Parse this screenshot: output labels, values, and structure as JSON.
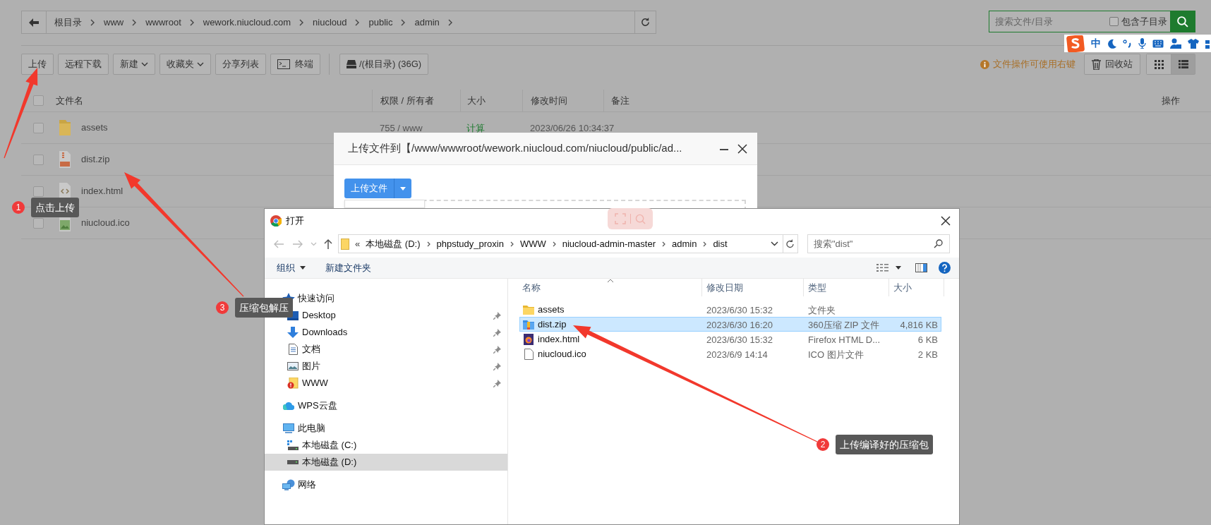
{
  "breadcrumb": {
    "segments": [
      "根目录",
      "www",
      "wwwroot",
      "wework.niucloud.com",
      "niucloud",
      "public",
      "admin"
    ]
  },
  "search": {
    "placeholder": "搜索文件/目录",
    "include_subdirs": {
      "label": "包含子目录",
      "checked": false
    }
  },
  "ime_toolbar": {
    "mode": "中"
  },
  "toolbar": [
    {
      "kind": "plain",
      "label": "上传"
    },
    {
      "kind": "plain",
      "label": "远程下载"
    },
    {
      "kind": "dropdown",
      "label": "新建"
    },
    {
      "kind": "dropdown",
      "label": "收藏夹"
    },
    {
      "kind": "plain",
      "label": "分享列表"
    },
    {
      "kind": "terminal",
      "label": "终端"
    },
    {
      "kind": "disk",
      "label": "/(根目录) (36G)"
    }
  ],
  "hint": "文件操作可使用右键",
  "recycle_button": "回收站",
  "views": [
    {
      "kind": "grid",
      "selected": false
    },
    {
      "kind": "list",
      "selected": true
    }
  ],
  "table": {
    "select_all": {
      "checked": false
    },
    "columns": [
      "文件名",
      "权限 / 所有者",
      "大小",
      "修改时间",
      "备注",
      "操作"
    ],
    "rows": [
      {
        "kind": "folder",
        "checked": false,
        "name": "assets",
        "permission": "755 / www",
        "size": "计算",
        "modified": "2023/06/26 10:34:37"
      },
      {
        "kind": "zip",
        "checked": false,
        "name": "dist.zip"
      },
      {
        "kind": "html",
        "checked": false,
        "name": "index.html"
      },
      {
        "kind": "image",
        "checked": false,
        "name": "niucloud.ico"
      }
    ]
  },
  "upload_dialog": {
    "title": "上传文件到【/www/wwwroot/wework.niucloud.com/niucloud/public/ad...",
    "upload_button": "上传文件"
  },
  "open_dialog": {
    "title": "打开",
    "address": {
      "overflow": "«",
      "segments": [
        "本地磁盘 (D:)",
        "phpstudy_proxin",
        "WWW",
        "niucloud-admin-master",
        "admin",
        "dist"
      ]
    },
    "search_placeholder": "搜索\"dist\"",
    "commands": [
      {
        "label": "组织",
        "dropdown": true
      },
      {
        "label": "新建文件夹",
        "dropdown": false
      }
    ],
    "nav": [
      {
        "label": "快速访问",
        "kind": "star",
        "selected": false,
        "children": [
          {
            "label": "Desktop",
            "kind": "desktop",
            "pinned": true,
            "selected": false
          },
          {
            "label": "Downloads",
            "kind": "download",
            "pinned": true,
            "selected": false
          },
          {
            "label": "文档",
            "kind": "document",
            "pinned": true,
            "selected": false
          },
          {
            "label": "图片",
            "kind": "pictures",
            "pinned": true,
            "selected": false
          },
          {
            "label": "WWW",
            "kind": "www",
            "pinned": true,
            "selected": false
          }
        ]
      },
      {
        "label": "WPS云盘",
        "kind": "cloud",
        "selected": false
      },
      {
        "label": "此电脑",
        "kind": "computer",
        "selected": false,
        "children": [
          {
            "label": "本地磁盘 (C:)",
            "kind": "system-drive",
            "selected": false
          },
          {
            "label": "本地磁盘 (D:)",
            "kind": "drive",
            "selected": true
          }
        ]
      },
      {
        "label": "网络",
        "kind": "network",
        "selected": false
      }
    ],
    "columns": [
      "名称",
      "修改日期",
      "类型",
      "大小"
    ],
    "files": [
      {
        "kind": "folder",
        "name": "assets",
        "modified": "2023/6/30 15:32",
        "type": "文件夹",
        "selected": false
      },
      {
        "kind": "zip",
        "name": "dist.zip",
        "modified": "2023/6/30 16:20",
        "type": "360压缩 ZIP 文件",
        "size": "4,816 KB",
        "selected": true
      },
      {
        "kind": "firefox",
        "name": "index.html",
        "modified": "2023/6/30 15:32",
        "type": "Firefox HTML D...",
        "size": "6 KB",
        "selected": false
      },
      {
        "kind": "file",
        "name": "niucloud.ico",
        "modified": "2023/6/9 14:14",
        "type": "ICO 图片文件",
        "size": "2 KB",
        "selected": false
      }
    ]
  },
  "annotations": [
    {
      "number": "1",
      "text": "点击上传"
    },
    {
      "number": "3",
      "text": "压缩包解压"
    },
    {
      "number": "2",
      "text": "上传编译好的压缩包"
    }
  ]
}
